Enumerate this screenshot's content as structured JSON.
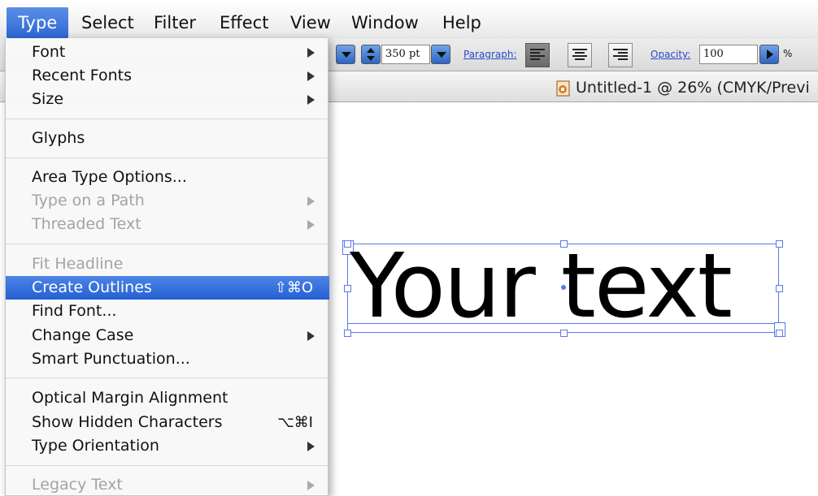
{
  "menubar": {
    "items": [
      "Type",
      "Select",
      "Filter",
      "Effect",
      "View",
      "Window",
      "Help"
    ]
  },
  "controlbar": {
    "size_value": "350 pt",
    "paragraph_label": "Paragraph:",
    "opacity_label": "Opacity:",
    "opacity_value": "100",
    "percent": "%"
  },
  "document": {
    "tab_title": "Untitled-1 @ 26% (CMYK/Previ",
    "sample_text": "Your text"
  },
  "type_menu": {
    "items": [
      {
        "label": "Font",
        "submenu": true,
        "enabled": true
      },
      {
        "label": "Recent Fonts",
        "submenu": true,
        "enabled": true
      },
      {
        "label": "Size",
        "submenu": true,
        "enabled": true
      },
      {
        "label": "Glyphs",
        "enabled": true
      },
      {
        "label": "Area Type Options...",
        "enabled": true
      },
      {
        "label": "Type on a Path",
        "submenu": true,
        "enabled": false
      },
      {
        "label": "Threaded Text",
        "submenu": true,
        "enabled": false
      },
      {
        "label": "Fit Headline",
        "enabled": false
      },
      {
        "label": "Create Outlines",
        "shortcut": "⇧⌘O",
        "enabled": true,
        "selected": true
      },
      {
        "label": "Find Font...",
        "enabled": true
      },
      {
        "label": "Change Case",
        "submenu": true,
        "enabled": true
      },
      {
        "label": "Smart Punctuation...",
        "enabled": true
      },
      {
        "label": "Optical Margin Alignment",
        "enabled": true
      },
      {
        "label": "Show Hidden Characters",
        "shortcut": "⌥⌘I",
        "enabled": true
      },
      {
        "label": "Type Orientation",
        "submenu": true,
        "enabled": true
      },
      {
        "label": "Legacy Text",
        "submenu": true,
        "enabled": false
      }
    ]
  },
  "colors": {
    "menu_highlight": "#2e66d3",
    "selection_blue": "#5a78f0",
    "link_blue": "#2b48c8"
  }
}
